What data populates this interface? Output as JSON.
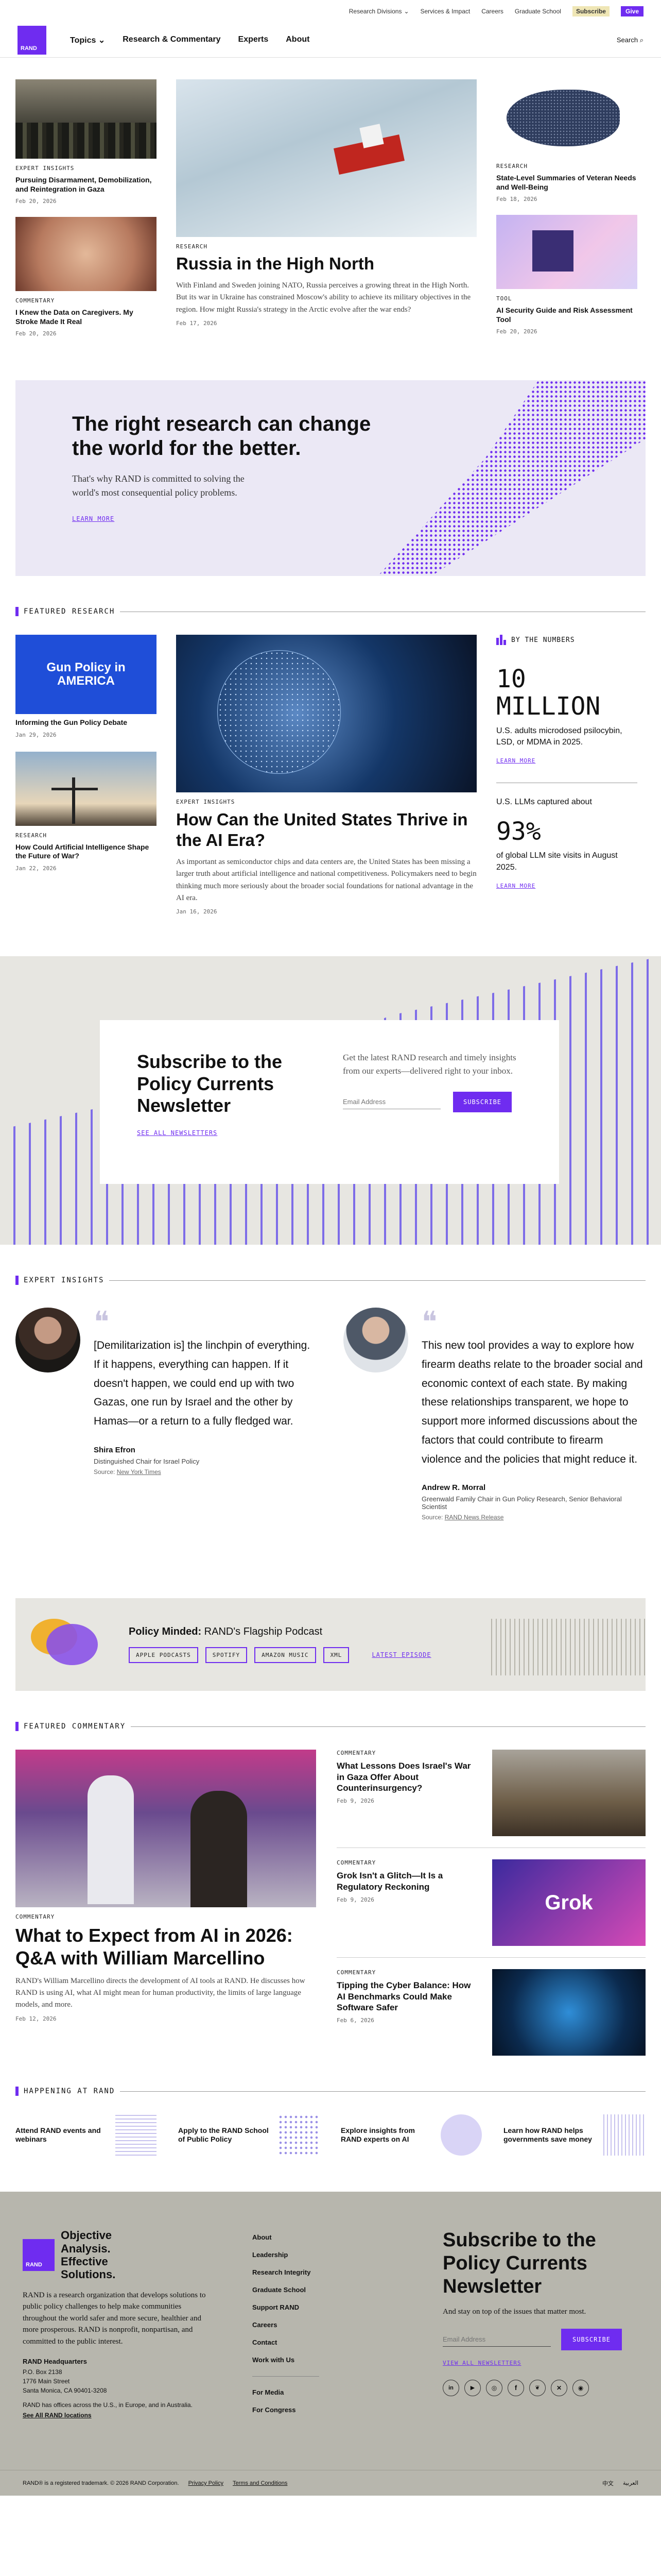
{
  "utility": {
    "items": [
      "Research Divisions",
      "Services & Impact",
      "Careers",
      "Graduate School"
    ],
    "subscribe": "Subscribe",
    "give": "Give"
  },
  "nav": {
    "logo": "RAND",
    "items": [
      "Topics",
      "Research & Commentary",
      "Experts",
      "About"
    ],
    "search": "Search"
  },
  "top": {
    "left": [
      {
        "tag": "EXPERT INSIGHTS",
        "title": "Pursuing Disarmament, Demobilization, and Reintegration in Gaza",
        "date": "Feb 20, 2026"
      },
      {
        "tag": "COMMENTARY",
        "title": "I Knew the Data on Caregivers. My Stroke Made It Real",
        "date": "Feb 20, 2026"
      }
    ],
    "feature": {
      "tag": "RESEARCH",
      "title": "Russia in the High North",
      "desc": "With Finland and Sweden joining NATO, Russia perceives a growing threat in the High North. But its war in Ukraine has constrained Moscow's ability to achieve its military objectives in the region. How might Russia's strategy in the Arctic evolve after the war ends?",
      "date": "Feb 17, 2026"
    },
    "right": [
      {
        "tag": "RESEARCH",
        "title": "State-Level Summaries of Veteran Needs and Well-Being",
        "date": "Feb 18, 2026"
      },
      {
        "tag": "TOOL",
        "title": "AI Security Guide and Risk Assessment Tool",
        "date": "Feb 20, 2026"
      }
    ]
  },
  "banner": {
    "title": "The right research can change the world for the better.",
    "body": "That's why RAND is committed to solving the world's most consequential policy problems.",
    "link": "LEARN MORE"
  },
  "featured": {
    "label": "FEATURED RESEARCH",
    "left": [
      {
        "img_text": "Gun Policy in AMERICA",
        "title": "Informing the Gun Policy Debate",
        "date": "Jan 29, 2026"
      },
      {
        "tag": "RESEARCH",
        "title": "How Could Artificial Intelligence Shape the Future of War?",
        "date": "Jan 22, 2026"
      }
    ],
    "main": {
      "tag": "EXPERT INSIGHTS",
      "title": "How Can the United States Thrive in the AI Era?",
      "desc": "As important as semiconductor chips and data centers are, the United States has been missing a larger truth about artificial intelligence and national competitiveness. Policymakers need to begin thinking much more seriously about the broader social foundations for national advantage in the AI era.",
      "date": "Jan 16, 2026"
    },
    "numbers": {
      "label": "BY THE NUMBERS",
      "big1": "10 MILLION",
      "text1": "U.S. adults microdosed psilocybin, LSD, or MDMA in 2025.",
      "link1": "LEARN MORE",
      "pre2": "U.S. LLMs captured about",
      "big2": "93%",
      "text2": "of global LLM site visits in August 2025.",
      "link2": "LEARN MORE"
    }
  },
  "subscribe": {
    "title": "Subscribe to the Policy Currents Newsletter",
    "link": "SEE ALL NEWSLETTERS",
    "body": "Get the latest RAND research and timely insights from our experts—delivered right to your inbox.",
    "placeholder": "Email Address",
    "button": "SUBSCRIBE"
  },
  "insights": {
    "label": "EXPERT INSIGHTS",
    "items": [
      {
        "quote": "[Demilitarization is] the linchpin of everything. If it happens, everything can happen. If it doesn't happen, we could end up with two Gazas, one run by Israel and the other by Hamas—or a return to a fully fledged war.",
        "name": "Shira Efron",
        "role": "Distinguished Chair for Israel Policy",
        "source_pre": "Source: ",
        "source": "New York Times"
      },
      {
        "quote": "This new tool provides a way to explore how firearm deaths relate to the broader social and economic context of each state. By making these relationships transparent, we hope to support more informed discussions about the factors that could contribute to firearm violence and the policies that might reduce it.",
        "name": "Andrew R. Morral",
        "role": "Greenwald Family Chair in Gun Policy Research, Senior Behavioral Scientist",
        "source_pre": "Source: ",
        "source": "RAND News Release"
      }
    ]
  },
  "podcast": {
    "title": "Policy Minded:",
    "subtitle": " RAND's Flagship Podcast",
    "buttons": [
      "APPLE PODCASTS",
      "SPOTIFY",
      "AMAZON MUSIC",
      "XML"
    ],
    "latest": "LATEST EPISODE"
  },
  "commentary": {
    "label": "FEATURED COMMENTARY",
    "main": {
      "tag": "COMMENTARY",
      "title": "What to Expect from AI in 2026: Q&A with William Marcellino",
      "desc": "RAND's William Marcellino directs the development of AI tools at RAND. He discusses how RAND is using AI, what AI might mean for human productivity, the limits of large language models, and more.",
      "date": "Feb 12, 2026"
    },
    "items": [
      {
        "tag": "COMMENTARY",
        "title": "What Lessons Does Israel's War in Gaza Offer About Counterinsurgency?",
        "date": "Feb 9, 2026"
      },
      {
        "tag": "COMMENTARY",
        "title": "Grok Isn't a Glitch—It Is a Regulatory Reckoning",
        "date": "Feb 9, 2026",
        "img_text": "Grok"
      },
      {
        "tag": "COMMENTARY",
        "title": "Tipping the Cyber Balance: How AI Benchmarks Could Make Software Safer",
        "date": "Feb 6, 2026"
      }
    ]
  },
  "happening": {
    "label": "HAPPENING AT RAND",
    "items": [
      "Attend RAND events and webinars",
      "Apply to the RAND School of Public Policy",
      "Explore insights from RAND experts on AI",
      "Learn how RAND helps governments save money"
    ]
  },
  "footer": {
    "brand": "Objective Analysis. Effective Solutions.",
    "about": "RAND is a research organization that develops solutions to public policy challenges to help make communities throughout the world safer and more secure, healthier and more prosperous. RAND is nonprofit, nonpartisan, and committed to the public interest.",
    "hq": "RAND Headquarters",
    "addr": [
      "P.O. Box 2138",
      "1776 Main Street",
      "Santa Monica, CA 90401-3208"
    ],
    "offices": "RAND has offices across the U.S., in Europe, and in Australia.",
    "all_locations": "See All RAND locations",
    "links": [
      "About",
      "Leadership",
      "Research Integrity",
      "Graduate School",
      "Support RAND",
      "Careers",
      "Contact",
      "Work with Us"
    ],
    "links2": [
      "For Media",
      "For Congress"
    ],
    "sub_title": "Subscribe to the Policy Currents Newsletter",
    "sub_body": "And stay on top of the issues that matter most.",
    "placeholder": "Email Address",
    "button": "SUBSCRIBE",
    "see_all": "VIEW ALL NEWSLETTERS",
    "social": [
      "linkedin-icon",
      "youtube-icon",
      "instagram-icon",
      "facebook-icon",
      "bluesky-icon",
      "x-icon",
      "podcast-icon"
    ],
    "legal": "RAND® is a registered trademark. © 2026 RAND Corporation.",
    "privacy": "Privacy Policy",
    "terms": "Terms and Conditions",
    "langs": [
      "中文",
      "العربية"
    ]
  },
  "colors": {
    "purple": "#6f2cf0",
    "banner_bg": "#ebe8f5",
    "gray_bg": "#e7e6e1",
    "footer_bg": "#b7b6ad"
  }
}
